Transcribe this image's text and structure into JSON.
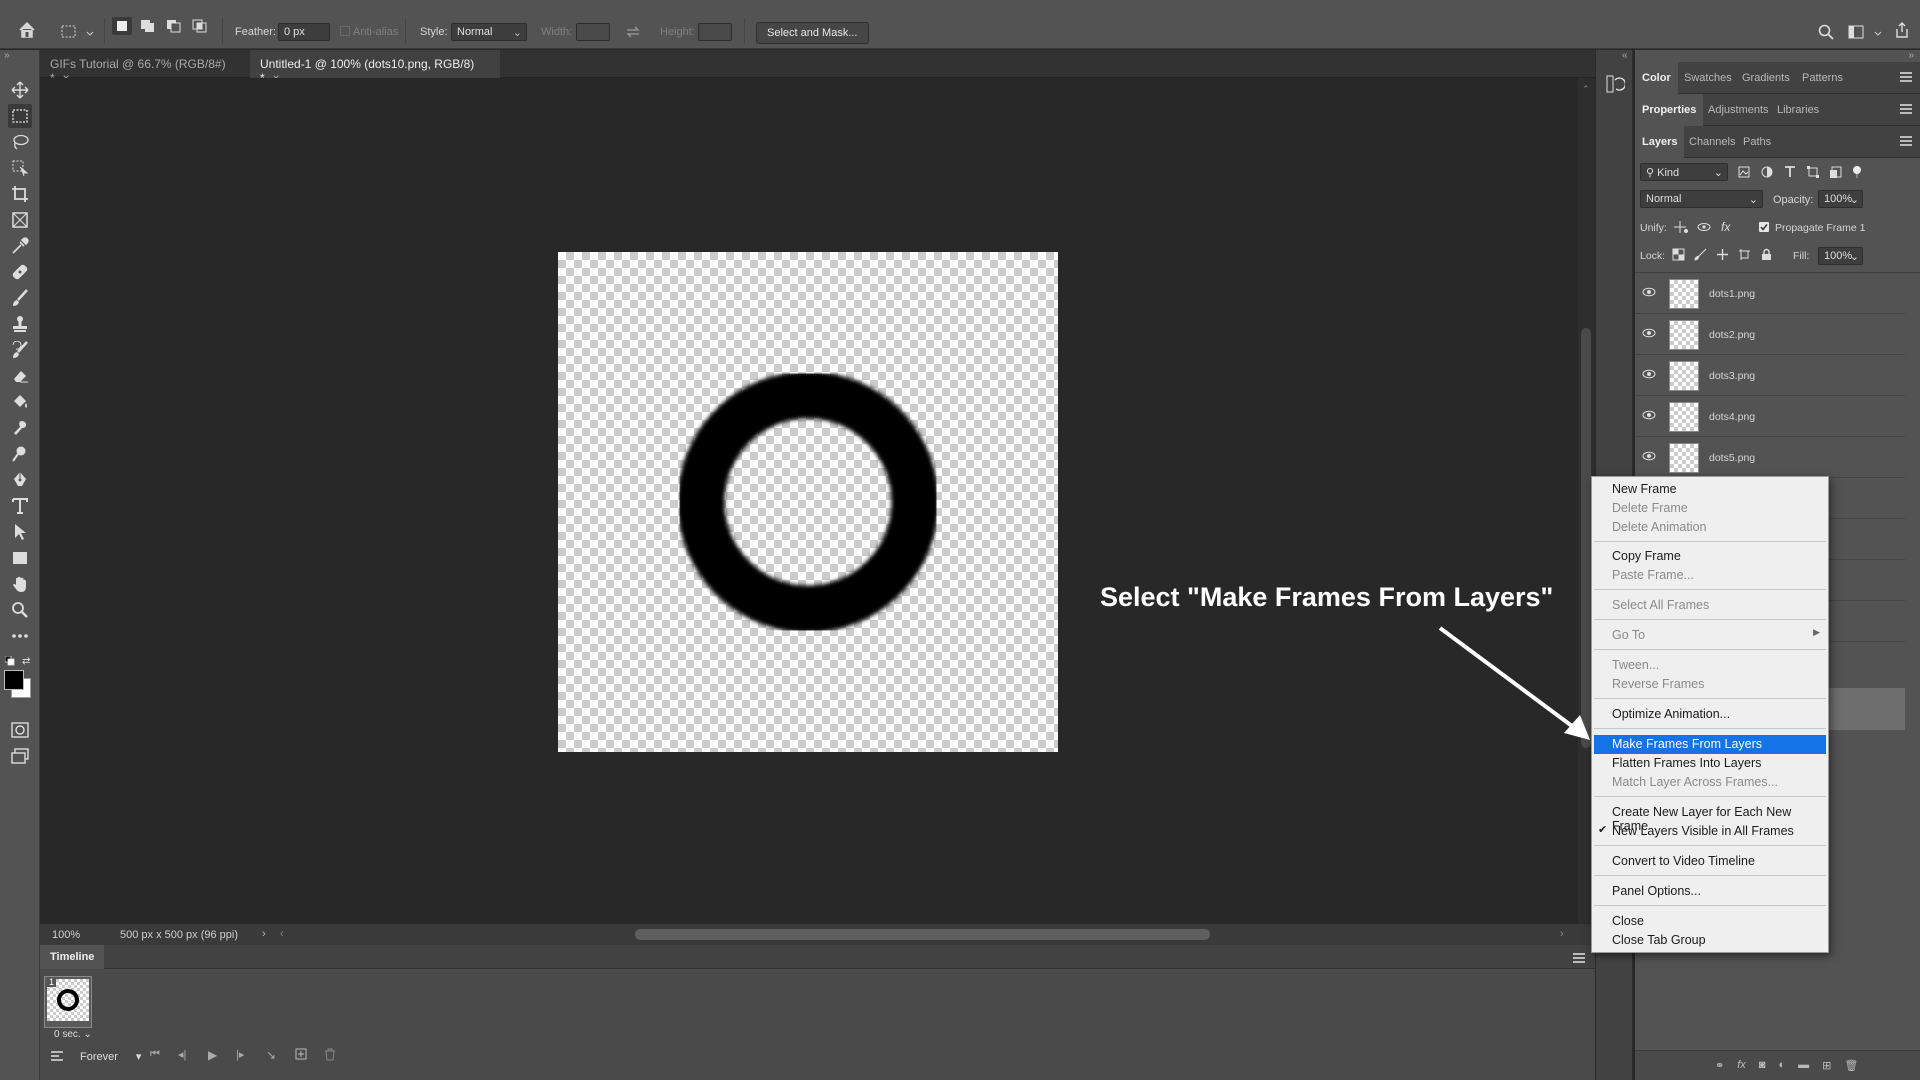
{
  "options_bar": {
    "feather_label": "Feather:",
    "feather_value": "0 px",
    "antialias_label": "Anti-alias",
    "style_label": "Style:",
    "style_value": "Normal",
    "width_label": "Width:",
    "height_label": "Height:",
    "select_mask_label": "Select and Mask..."
  },
  "document_tabs": [
    {
      "label": "GIFs Tutorial @ 66.7% (RGB/8#) *",
      "close": "×"
    },
    {
      "label": "Untitled-1 @ 100% (dots10.png, RGB/8) *",
      "close": "×"
    }
  ],
  "status_bar": {
    "zoom": "100%",
    "doc_info": "500 px x 500 px (96 ppi)"
  },
  "timeline": {
    "title": "Timeline",
    "frame_number": "1",
    "frame_delay": "0 sec.",
    "loop_value": "Forever"
  },
  "panels": {
    "group1_tabs": [
      "Color",
      "Swatches",
      "Gradients",
      "Patterns"
    ],
    "group2_tabs": [
      "Properties",
      "Adjustments",
      "Libraries"
    ],
    "group3_tabs": [
      "Layers",
      "Channels",
      "Paths"
    ],
    "filter_kind": "Kind",
    "blend_mode": "Normal",
    "opacity_label": "Opacity:",
    "opacity_value": "100%",
    "unify_label": "Unify:",
    "propagate_label": "Propagate Frame 1",
    "lock_label": "Lock:",
    "fill_label": "Fill:",
    "fill_value": "100%"
  },
  "layers": [
    "dots1.png",
    "dots2.png",
    "dots3.png",
    "dots4.png",
    "dots5.png"
  ],
  "context_menu": {
    "items": [
      {
        "label": "New Frame"
      },
      {
        "label": "Delete Frame"
      },
      {
        "label": "Delete Animation"
      },
      {
        "label": "Copy Frame"
      },
      {
        "label": "Paste Frame..."
      },
      {
        "label": "Select All Frames"
      },
      {
        "label": "Go To"
      },
      {
        "label": "Tween..."
      },
      {
        "label": "Reverse Frames"
      },
      {
        "label": "Optimize Animation..."
      },
      {
        "label": "Make Frames From Layers"
      },
      {
        "label": "Flatten Frames Into Layers"
      },
      {
        "label": "Match Layer Across Frames..."
      },
      {
        "label": "Create New Layer for Each New Frame"
      },
      {
        "label": "New Layers Visible in All Frames"
      },
      {
        "label": "Convert to Video Timeline"
      },
      {
        "label": "Panel Options..."
      },
      {
        "label": "Close"
      },
      {
        "label": "Close Tab Group"
      }
    ]
  },
  "annotation": "Select \"Make Frames From Layers\"",
  "colors": {
    "highlight": "#1473e6",
    "panel_bg": "#535353",
    "canvas_bg": "#282828"
  }
}
